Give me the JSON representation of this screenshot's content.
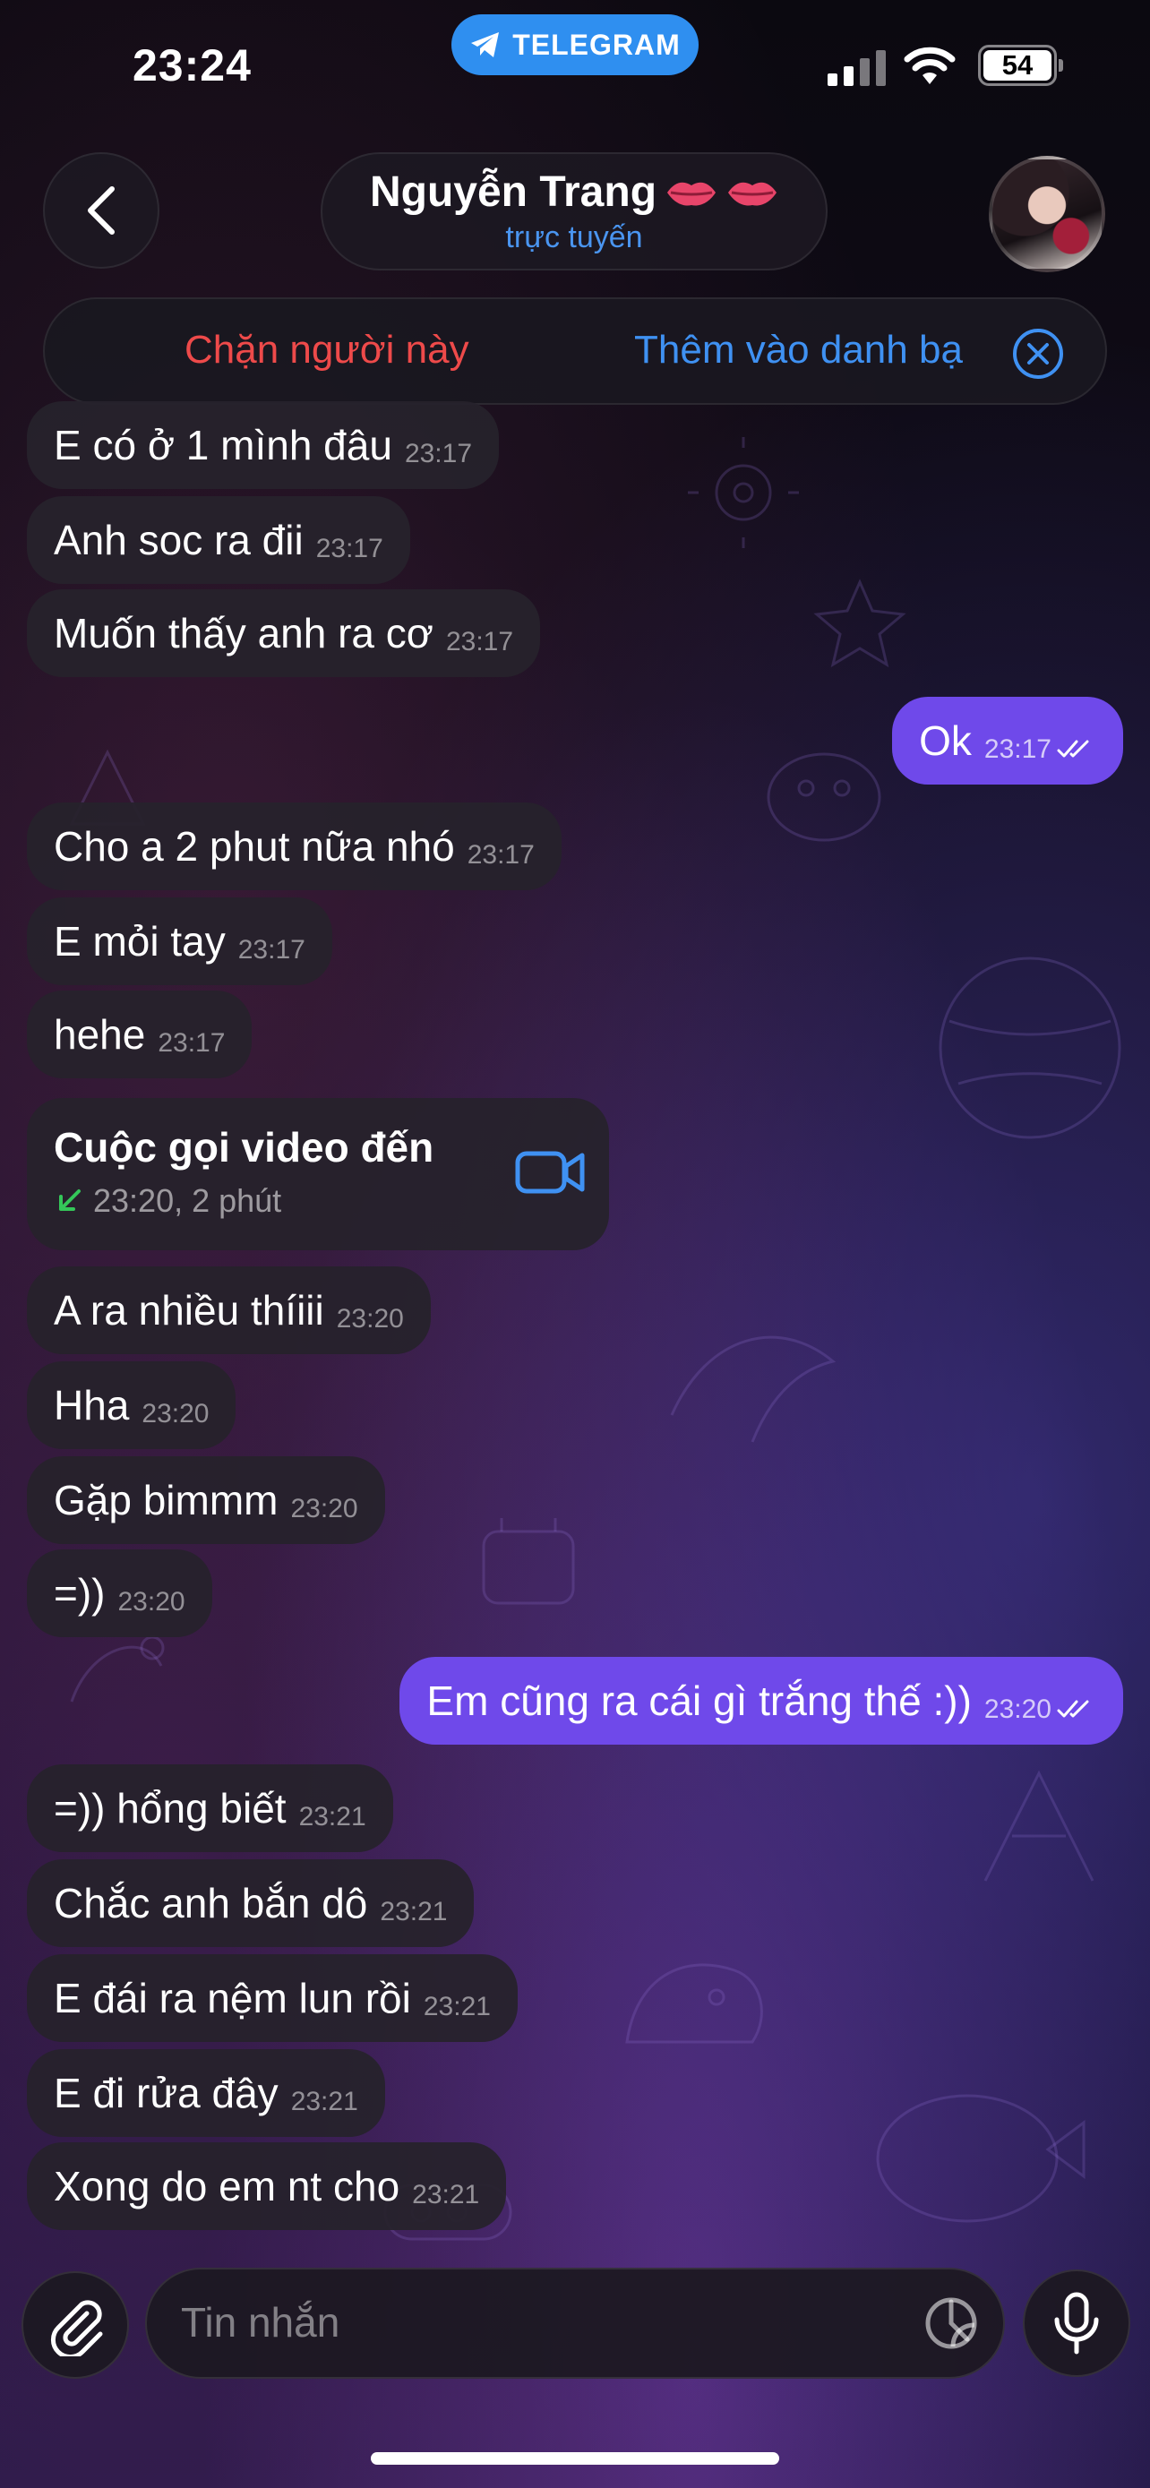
{
  "status_bar": {
    "time": "23:24",
    "app_pill_label": "TELEGRAM",
    "battery": "54"
  },
  "header": {
    "contact_name": "Nguyễn Trang",
    "contact_status": "trực tuyến",
    "name_decoration_icon": "lips-emoji"
  },
  "action_bar": {
    "block_label": "Chặn người này",
    "add_contact_label": "Thêm vào danh bạ"
  },
  "messages": [
    {
      "dir": "in",
      "text": "E có ở 1 mình đâu",
      "time": "23:17"
    },
    {
      "dir": "in",
      "text": "Anh soc  ra đii",
      "time": "23:17"
    },
    {
      "dir": "in",
      "text": "Muốn thấy anh ra cơ",
      "time": "23:17"
    },
    {
      "dir": "out",
      "text": "Ok",
      "time": "23:17"
    },
    {
      "dir": "in",
      "text": "Cho a 2 phut nữa nhó",
      "time": "23:17"
    },
    {
      "dir": "in",
      "text": "E mỏi tay",
      "time": "23:17"
    },
    {
      "dir": "in",
      "text": "hehe",
      "time": "23:17"
    },
    {
      "dir": "in",
      "text": "A ra nhiều thíiii",
      "time": "23:20"
    },
    {
      "dir": "in",
      "text": "Hha",
      "time": "23:20"
    },
    {
      "dir": "in",
      "text": "Gặp bimmm",
      "time": "23:20"
    },
    {
      "dir": "in",
      "text": "=))",
      "time": "23:20"
    },
    {
      "dir": "out",
      "text": "Em cũng ra cái gì trắng thế :))",
      "time": "23:20"
    },
    {
      "dir": "in",
      "text": "=)) hổng biết",
      "time": "23:21"
    },
    {
      "dir": "in",
      "text": "Chắc anh bắn dô",
      "time": "23:21"
    },
    {
      "dir": "in",
      "text": "E đái ra nệm lun rồi",
      "time": "23:21"
    },
    {
      "dir": "in",
      "text": "E đi rửa đây",
      "time": "23:21"
    },
    {
      "dir": "in",
      "text": "Xong do em nt cho",
      "time": "23:21"
    }
  ],
  "call": {
    "title": "Cuộc gọi video đến",
    "meta": "23:20, 2 phút"
  },
  "composer": {
    "placeholder": "Tin nhắn"
  },
  "colors": {
    "accent_blue": "#3f91f2",
    "danger_red": "#ee4a4a",
    "outgoing_bubble": "#6f49ea",
    "incoming_bubble": "#26222c",
    "call_arrow_green": "#34c759"
  }
}
